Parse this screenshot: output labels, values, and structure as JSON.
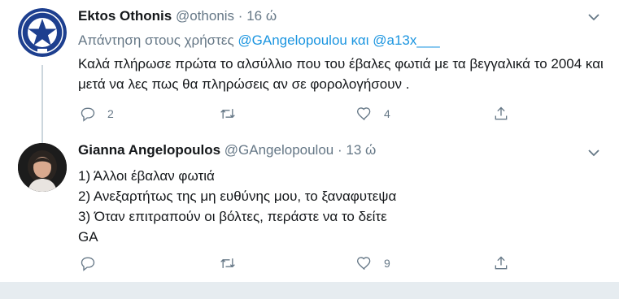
{
  "tweets": [
    {
      "name": "Ektos Othonis",
      "handle": "@othonis",
      "separator": "·",
      "time": "16 ώ",
      "avatar": "logo-avatar",
      "reply_prefix": "Απάντηση στους χρήστες",
      "reply_mention_1": "@GAngelopoulou",
      "reply_and": "και",
      "reply_mention_2": "@a13x___",
      "text": "Καλά πλήρωσε πρώτα το αλσύλλιο που του έβαλες φωτιά με τα βεγγαλικά το 2004 και μετά να λες πως θα πληρώσεις αν σε φορολογήσουν .",
      "reply_count": "2",
      "retweet_count": "",
      "like_count": "4"
    },
    {
      "name": "Gianna Angelopoulos",
      "handle": "@GAngelopoulou",
      "separator": "·",
      "time": "13 ώ",
      "avatar": "photo-avatar",
      "lines": [
        "1) Άλλοι έβαλαν φωτιά",
        "2) Ανεξαρτήτως της μη ευθύνης μου, το ξαναφυτεψα",
        "3) Όταν επιτραπούν οι βόλτες, περάστε να το δείτε",
        "GA"
      ],
      "reply_count": "",
      "retweet_count": "",
      "like_count": "9"
    }
  ],
  "icons": [
    "caret-down-icon",
    "reply-icon",
    "retweet-icon",
    "like-icon",
    "share-icon"
  ],
  "colors": {
    "link": "#1b95e0",
    "muted": "#657786",
    "text": "#14171a",
    "border": "#e6ecf0"
  }
}
